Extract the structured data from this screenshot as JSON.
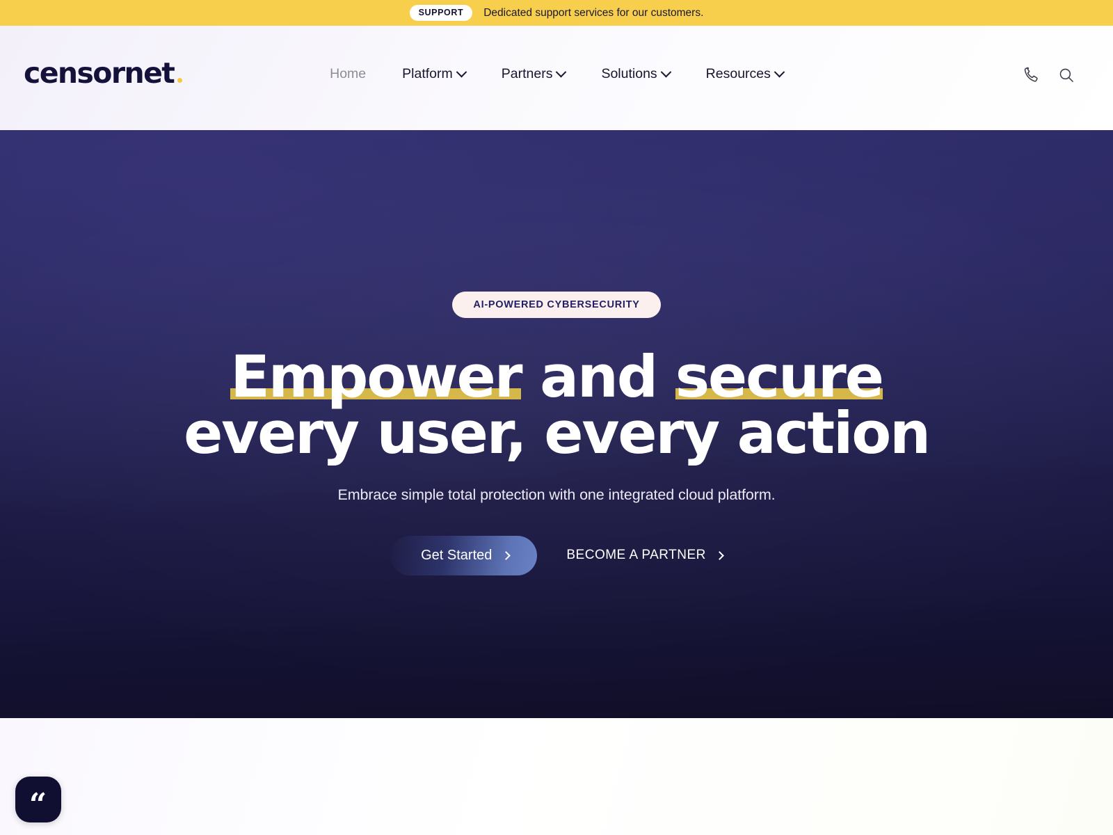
{
  "banner": {
    "tag": "SUPPORT",
    "message": "Dedicated support services for our customers.",
    "bg_color": "#f7cf4d"
  },
  "header": {
    "logo_text": "censornet",
    "logo_dot_color": "#f5c842",
    "nav": [
      {
        "label": "Home",
        "has_dropdown": false,
        "active": true
      },
      {
        "label": "Platform",
        "has_dropdown": true,
        "active": false
      },
      {
        "label": "Partners",
        "has_dropdown": true,
        "active": false
      },
      {
        "label": "Solutions",
        "has_dropdown": true,
        "active": false
      },
      {
        "label": "Resources",
        "has_dropdown": true,
        "active": false
      }
    ],
    "actions": [
      {
        "icon": "phone-icon"
      },
      {
        "icon": "search-icon"
      }
    ]
  },
  "hero": {
    "badge": "AI-POWERED CYBERSECURITY",
    "title_line1_part1": "Empower",
    "title_line1_part2": "and",
    "title_line1_part3": "secure",
    "title_line2": "every user, every action",
    "subtitle": "Embrace simple total protection with one integrated cloud platform.",
    "primary_cta": "Get Started",
    "secondary_cta": "BECOME A PARTNER",
    "highlight_color": "#d6b749",
    "bg_top_color": "#2e2c68",
    "bg_bottom_color": "#100e26"
  },
  "chat": {
    "icon": "quote-icon",
    "glyph": "“"
  }
}
